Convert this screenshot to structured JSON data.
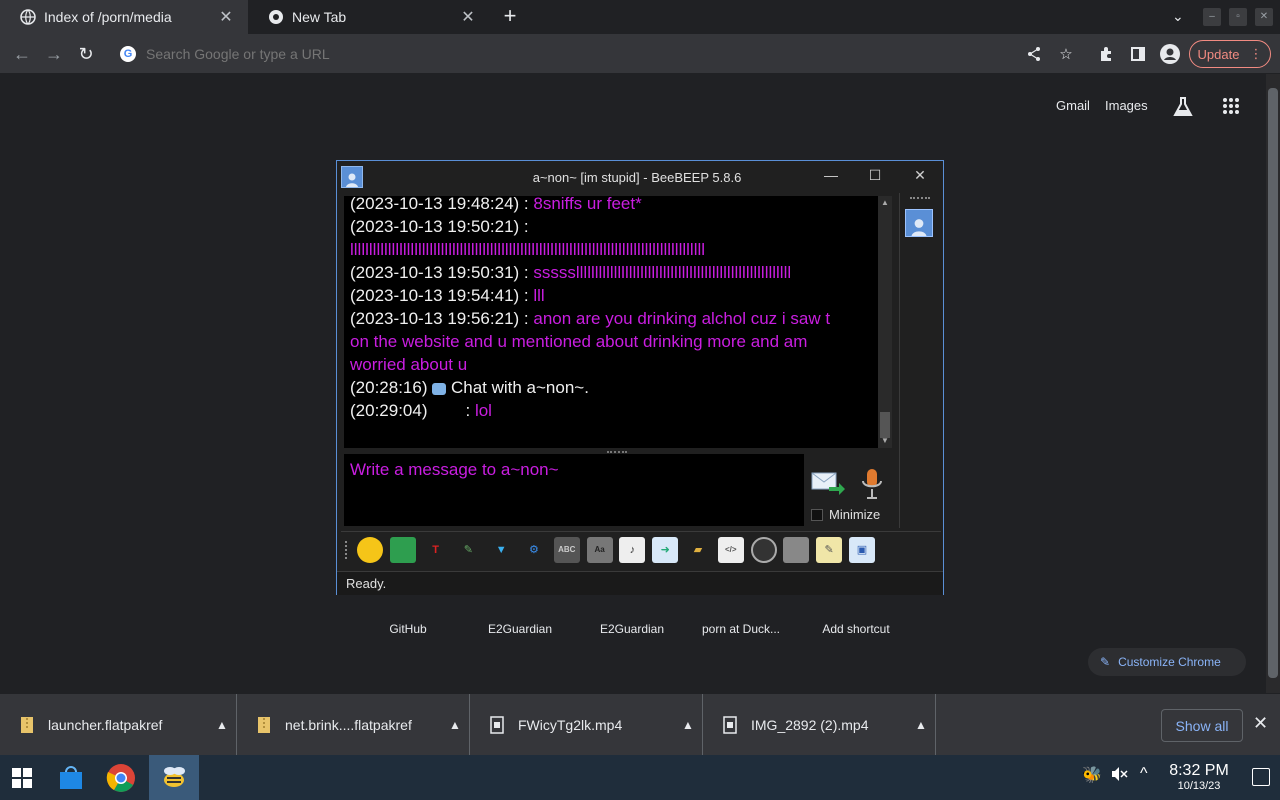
{
  "browser": {
    "tabs": [
      {
        "title": "Index of /porn/media",
        "active": true
      },
      {
        "title": "New Tab",
        "active": false
      }
    ],
    "omnibox": {
      "placeholder": "Search Google or type a URL"
    },
    "update_label": "Update"
  },
  "newtab": {
    "links": {
      "gmail": "Gmail",
      "images": "Images"
    },
    "shortcuts": [
      "GitHub",
      "E2Guardian",
      "E2Guardian",
      "porn at Duck...",
      "Add shortcut"
    ],
    "customize_label": "Customize Chrome"
  },
  "beebeep": {
    "title": "a~non~ [im stupid] - BeeBEEP 5.8.6",
    "messages": [
      {
        "ts": "(2023-10-13 19:48:24) : ",
        "text": "8sniffs ur feet*"
      },
      {
        "ts": "(2023-10-13 19:50:21) : ",
        "text": ""
      },
      {
        "ts": "",
        "text": "llllllllllllllllllllllllllllllllllllllllllllllllllllllllllllllllllllllllllllllllllllllllllllll"
      },
      {
        "ts": "(2023-10-13 19:50:31) : ",
        "text": "ssssslllllllllllllllllllllllllllllllllllllllllllllllllllllllll"
      },
      {
        "ts": "(2023-10-13 19:54:41) : ",
        "text": "lll"
      },
      {
        "ts": "(2023-10-13 19:56:21) : ",
        "text": "anon are you drinking alchol cuz i saw t"
      },
      {
        "ts": "",
        "text": "on the website and u mentioned about drinking more and am"
      },
      {
        "ts": "",
        "text": "worried about u"
      }
    ],
    "system_line": {
      "ts": "(20:28:16)",
      "text": " Chat with a~non~."
    },
    "last_line": {
      "ts": "(20:29:04)",
      "sep": ": ",
      "text": "lol"
    },
    "input_placeholder": "Write a message to a~non~",
    "minimize_label": "Minimize",
    "status": "Ready.",
    "toolbar_icons": [
      "emoticons-icon",
      "send-file-icon",
      "font-icon",
      "color-icon",
      "filter-icon",
      "settings-icon",
      "spellcheck-icon",
      "dictionary-icon",
      "music-icon",
      "share-icon",
      "folder-icon",
      "html-icon",
      "screenshot-icon",
      "file-cabinet-icon",
      "notepad-icon",
      "save-chat-icon"
    ],
    "accent_color": "#c91ee0"
  },
  "downloads": [
    {
      "name": "launcher.flatpakref"
    },
    {
      "name": "net.brink....flatpakref"
    },
    {
      "name": "FWicyTg2lk.mp4"
    },
    {
      "name": "IMG_2892 (2).mp4"
    }
  ],
  "show_all_label": "Show all",
  "taskbar": {
    "time": "8:32 PM",
    "date": "10/13/23"
  }
}
